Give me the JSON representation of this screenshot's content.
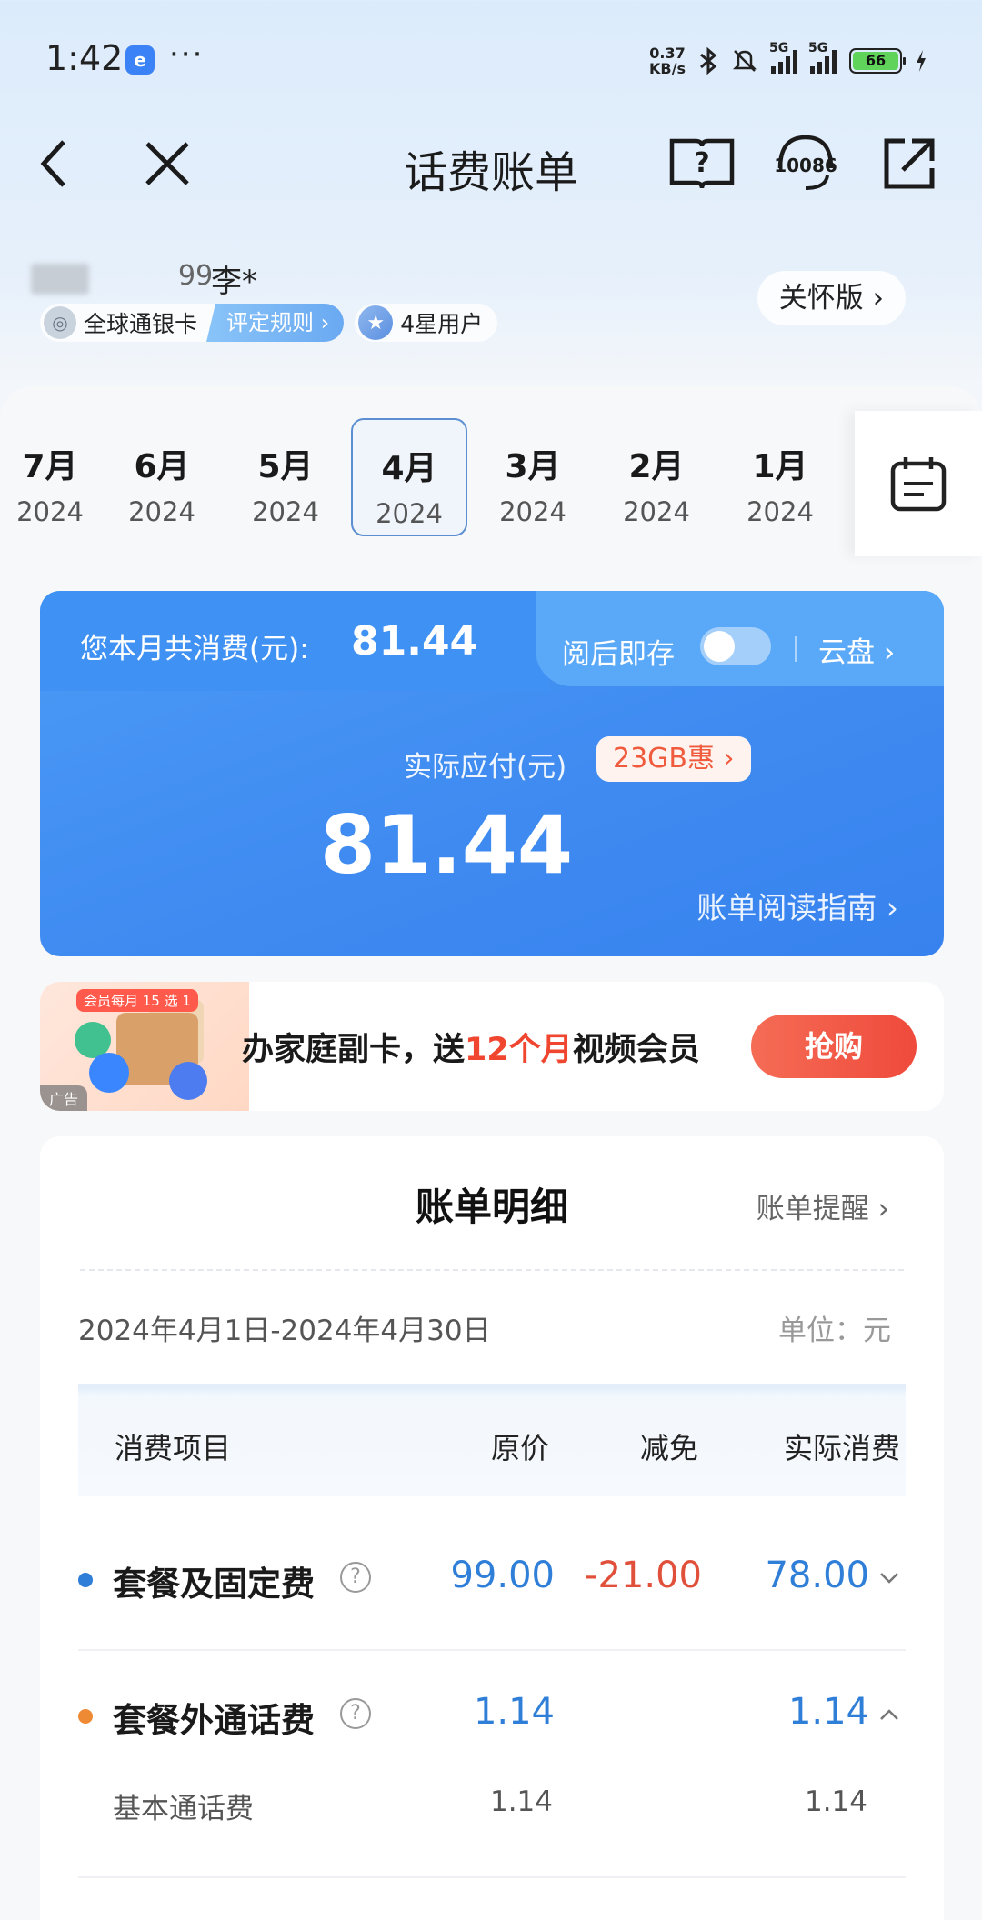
{
  "status_bar": {
    "time": "1:42",
    "app_icon": "e",
    "more": "···",
    "net_speed_value": "0.37",
    "net_speed_unit": "KB/s",
    "signal_tag_1": "5G",
    "signal_tag_2": "5G",
    "battery": "66",
    "icons": [
      "bluetooth-icon",
      "mute-icon",
      "signal-icon",
      "battery-icon",
      "charging-icon"
    ]
  },
  "nav": {
    "title": "话费账单",
    "service_number": "10086",
    "icons": [
      "back-icon",
      "close-icon",
      "help-book-icon",
      "service-headset-icon",
      "share-icon"
    ]
  },
  "user": {
    "name_tail": "99",
    "name": "李*",
    "card_label": "全球通银卡",
    "rule_label": "评定规则 ›",
    "star_label": "4星用户",
    "care_button": "关怀版 ›"
  },
  "months": [
    {
      "month": "7月",
      "year": "2024",
      "active": false
    },
    {
      "month": "6月",
      "year": "2024",
      "active": false
    },
    {
      "month": "5月",
      "year": "2024",
      "active": false
    },
    {
      "month": "4月",
      "year": "2024",
      "active": true
    },
    {
      "month": "3月",
      "year": "2024",
      "active": false
    },
    {
      "month": "2月",
      "year": "2024",
      "active": false
    },
    {
      "month": "1月",
      "year": "2024",
      "active": false
    }
  ],
  "bill": {
    "total_label": "您本月共消费(元):",
    "total_value": "81.44",
    "save_label": "阅后即存",
    "cloud_label": "云盘 ›",
    "pay_label": "实际应付(元)",
    "badge": "23GB惠 ›",
    "pay_value": "81.44",
    "guide": "账单阅读指南 ›"
  },
  "ad": {
    "corner": "会员每月 15 选 1",
    "label": "广告",
    "text_a": "办家庭副卡，送",
    "text_hl": "12个月",
    "text_b": "视频会员",
    "button": "抢购"
  },
  "detail": {
    "title": "账单明细",
    "remind": "账单提醒 ›",
    "period": "2024年4月1日-2024年4月30日",
    "unit": "单位：元",
    "columns": [
      "消费项目",
      "原价",
      "减免",
      "实际消费"
    ],
    "rows": [
      {
        "name": "套餐及固定费",
        "original": "99.00",
        "discount": "-21.00",
        "actual": "78.00",
        "dot": "#2f7fd8",
        "expanded": false
      },
      {
        "name": "套餐外通话费",
        "original": "1.14",
        "discount": "",
        "actual": "1.14",
        "dot": "#ef8a34",
        "expanded": true,
        "sub": [
          {
            "name": "基本通话费",
            "original": "1.14",
            "actual": "1.14"
          }
        ]
      }
    ]
  }
}
